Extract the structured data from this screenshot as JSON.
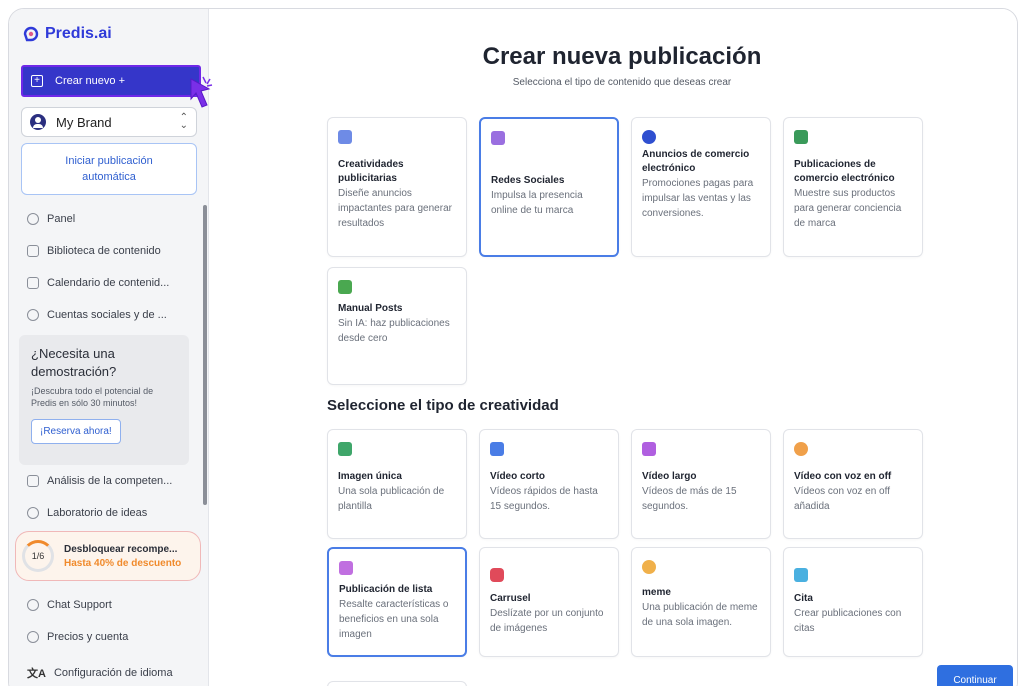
{
  "app": {
    "logo_text": "Predis.ai",
    "brand_color": "#2f3ad9"
  },
  "sidebar": {
    "create_button": "Crear nuevo +",
    "brand_select": "My Brand",
    "auto_button": "Iniciar publicación automática",
    "nav_top": [
      {
        "label": "Panel",
        "icon": "home-icon"
      },
      {
        "label": "Biblioteca de contenido",
        "icon": "folder-icon"
      },
      {
        "label": "Calendario de contenid...",
        "icon": "calendar-icon"
      },
      {
        "label": "Cuentas sociales y de ...",
        "icon": "globe-icon"
      }
    ],
    "demo": {
      "title": "¿Necesita una demostración?",
      "subtitle": "¡Descubra todo el potencial de Predis en sólo 30 minutos!",
      "button": "¡Reserva ahora!"
    },
    "nav_mid": [
      {
        "label": "Análisis de la competen...",
        "icon": "chart-icon"
      },
      {
        "label": "Laboratorio de ideas",
        "icon": "lab-icon"
      }
    ],
    "unlock": {
      "progress": "1/6",
      "title": "Desbloquear recompe...",
      "subtitle": "Hasta 40% de descuento"
    },
    "nav_bottom": [
      {
        "label": "Chat Support",
        "icon": "support-icon"
      },
      {
        "label": "Precios y cuenta",
        "icon": "account-icon"
      },
      {
        "label": "Configuración de idioma",
        "icon": "language-icon"
      }
    ]
  },
  "main": {
    "title": "Crear nueva publicación",
    "subtitle": "Selecciona el tipo de contenido que deseas crear",
    "content_types": [
      {
        "title": "Creatividades publicitarias",
        "desc": "Diseñe anuncios impactantes para generar resultados",
        "icon": "document-icon",
        "color": "#6e8be6"
      },
      {
        "title": "Redes Sociales",
        "desc": "Impulsa la presencia online de tu marca",
        "icon": "edit-icon",
        "color": "#9a6fe0",
        "selected": true
      },
      {
        "title": "Anuncios de comercio electrónico",
        "desc": "Promociones pagas para impulsar las ventas y las conversiones.",
        "icon": "star-badge-icon",
        "color": "#2f4fd0"
      },
      {
        "title": "Publicaciones de comercio electrónico",
        "desc": "Muestre sus productos para generar conciencia de marca",
        "icon": "shop-icon",
        "color": "#3a9a5a"
      },
      {
        "title": "Manual Posts",
        "desc": "Sin IA: haz publicaciones desde cero",
        "icon": "megaphone-icon",
        "color": "#4aa850"
      }
    ],
    "section_title": "Seleccione el tipo de creatividad",
    "creative_types": [
      {
        "title": "Imagen única",
        "desc": "Una sola publicación de plantilla",
        "icon": "image-icon",
        "color": "#3fa66a"
      },
      {
        "title": "Vídeo corto",
        "desc": "Vídeos rápidos de hasta 15 segundos.",
        "icon": "video-icon",
        "color": "#4a7de6"
      },
      {
        "title": "Vídeo largo",
        "desc": "Vídeos de más de 15 segundos.",
        "icon": "film-icon",
        "color": "#b05fe0"
      },
      {
        "title": "Vídeo con voz en off",
        "desc": "Vídeos con voz en off añadida",
        "icon": "voice-icon",
        "color": "#f0a04a"
      },
      {
        "title": "Publicación de lista",
        "desc": "Resalte características o beneficios en una sola imagen",
        "icon": "list-icon",
        "color": "#c06fe0",
        "selected": true
      },
      {
        "title": "Carrusel",
        "desc": "Deslízate por un conjunto de imágenes",
        "icon": "carousel-icon",
        "color": "#e04a5a"
      },
      {
        "title": "meme",
        "desc": "Una publicación de meme de una sola imagen.",
        "icon": "emoji-icon",
        "color": "#f0b04a"
      },
      {
        "title": "Cita",
        "desc": "Crear publicaciones con citas",
        "icon": "quote-icon",
        "color": "#4ab0e0"
      }
    ],
    "continue_button": "Continuar"
  }
}
